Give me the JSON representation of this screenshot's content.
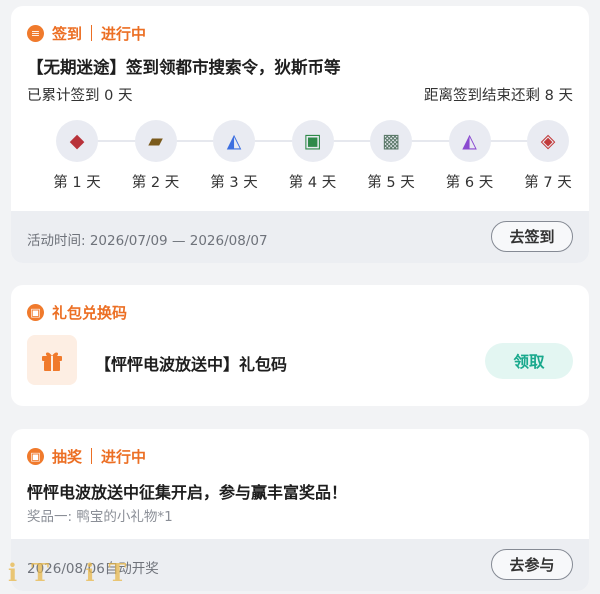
{
  "checkin": {
    "section_title": "签到",
    "status": "进行中",
    "title": "【无期迷途】签到领都市搜索令，狄斯币等",
    "count_text": "已累计签到 0 天",
    "remaining_text": "距离签到结束还剩 8 天",
    "days": [
      {
        "label": "第 1 天",
        "icon": "red-crystal-icon",
        "glyph": "◆",
        "color": "#b8323a"
      },
      {
        "label": "第 2 天",
        "icon": "gold-chip-icon",
        "glyph": "▰",
        "color": "#7a5a1c"
      },
      {
        "label": "第 3 天",
        "icon": "blue-crystal-icon",
        "glyph": "◭",
        "color": "#3d6fe0"
      },
      {
        "label": "第 4 天",
        "icon": "green-crate-icon",
        "glyph": "▣",
        "color": "#2f8a4a"
      },
      {
        "label": "第 5 天",
        "icon": "device-icon",
        "glyph": "▩",
        "color": "#5c7a6a"
      },
      {
        "label": "第 6 天",
        "icon": "purple-crystal-icon",
        "glyph": "◭",
        "color": "#8a4ad0"
      },
      {
        "label": "第 7 天",
        "icon": "red-ticket-icon",
        "glyph": "◈",
        "color": "#c23a3a"
      }
    ],
    "activity_time": "活动时间: 2026/07/09 — 2026/08/07",
    "button_label": "去签到"
  },
  "gift": {
    "section_title": "礼包兑换码",
    "label": "【怦怦电波放送中】礼包码",
    "button_label": "领取"
  },
  "lottery": {
    "section_title": "抽奖",
    "status": "进行中",
    "title": "怦怦电波放送中征集开启，参与赢丰富奖品！",
    "prize": "奖品一: 鸭宝的小礼物*1",
    "draw_time": "2026/08/06自动开奖",
    "button_label": "去参与"
  },
  "watermark": "iT iT"
}
